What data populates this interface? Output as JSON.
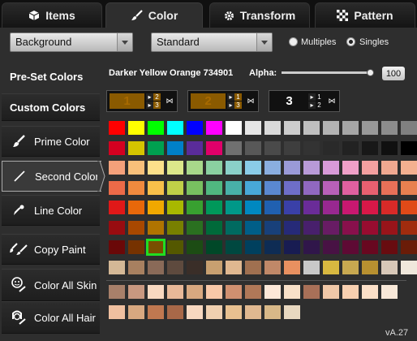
{
  "tabs": [
    {
      "label": "Items",
      "icon": "cube-icon"
    },
    {
      "label": "Color",
      "icon": "paintbrush-icon"
    },
    {
      "label": "Transform",
      "icon": "gear-icon"
    },
    {
      "label": "Pattern",
      "icon": "checker-icon"
    }
  ],
  "controls": {
    "target_select": "Background",
    "mode_select": "Standard",
    "radio_multiples": "Multiples",
    "radio_singles": "Singles",
    "selected_radio": "Singles"
  },
  "sidebar": {
    "preset_label": "Pre-Set Colors",
    "custom_label": "Custom Colors",
    "buttons": [
      {
        "label": "Prime Color",
        "icon": "brush-icon"
      },
      {
        "label": "Second Color",
        "icon": "pencil-icon",
        "active": true
      },
      {
        "label": "Line Color",
        "icon": "pen-icon"
      },
      {
        "label": "Copy Paint",
        "icon": "copy-paint-icon"
      },
      {
        "label": "Color All Skin",
        "icon": "skin-icon"
      },
      {
        "label": "Color All Hair",
        "icon": "hair-icon"
      }
    ]
  },
  "color_name": "Darker Yellow Orange 734901",
  "alpha": {
    "label": "Alpha:",
    "value": "100"
  },
  "slots": [
    {
      "number": "1",
      "color": "#8a5a00",
      "mini": [
        "▸",
        "2",
        "▸",
        "3"
      ]
    },
    {
      "number": "2",
      "color": "#8a5a00",
      "mini": [
        "▸",
        "1",
        "▸",
        "3"
      ]
    },
    {
      "number": "3",
      "color": "#111111",
      "mini": [
        "▸",
        "1",
        "▸",
        "2"
      ]
    }
  ],
  "palette_rows": [
    [
      "#ff0000",
      "#ffff00",
      "#00ff00",
      "#00ffff",
      "#0000ff",
      "#ff00ff",
      "#ffffff",
      "#e6e6e6",
      "#d9d9d9",
      "#cccccc",
      "#bfbfbf",
      "#b3b3b3",
      "#a6a6a6",
      "#999999",
      "#8c8c8c",
      "#808080"
    ],
    [
      "#d40020",
      "#d4c400",
      "#00a050",
      "#0080c8",
      "#5a2c9a",
      "#e0006a",
      "#707070",
      "#585858",
      "#4a4a4a",
      "#3e3e3e",
      "#333333",
      "#2a2a2a",
      "#222222",
      "#181818",
      "#101010",
      "#000000"
    ],
    [
      "#f4a07a",
      "#f8c07a",
      "#fce08a",
      "#dce88a",
      "#a8d88a",
      "#8ad0a0",
      "#8ad0c8",
      "#8acce8",
      "#8aaee0",
      "#9a9ad8",
      "#b89ad8",
      "#d89ad8",
      "#f0a0c8",
      "#f4a0a0",
      "#f0a890",
      "#f4b090"
    ],
    [
      "#ec6a48",
      "#f08a3e",
      "#f8c04a",
      "#c0d048",
      "#78c060",
      "#50b880",
      "#48b0a8",
      "#48a8d8",
      "#5a88d0",
      "#6e6ec8",
      "#9068c0",
      "#b860b8",
      "#e060a0",
      "#e86070",
      "#e87058",
      "#e88050"
    ],
    [
      "#e01818",
      "#e8680a",
      "#f0a800",
      "#a8b800",
      "#38a030",
      "#00985a",
      "#009888",
      "#0088c0",
      "#2060b0",
      "#3a40a8",
      "#6a2c98",
      "#982890",
      "#c81870",
      "#d81848",
      "#d82a28",
      "#e04a18"
    ],
    [
      "#980c10",
      "#a84800",
      "#b07400",
      "#788000",
      "#2a7020",
      "#006a3a",
      "#006a60",
      "#005e88",
      "#18407a",
      "#262a78",
      "#48206c",
      "#681c64",
      "#88104c",
      "#980c30",
      "#98141a",
      "#a02c0e"
    ],
    [
      "#6a0808",
      "#763200",
      "#784f00",
      "#545800",
      "#1c4c14",
      "#004828",
      "#004840",
      "#00405e",
      "#0e2c54",
      "#181c52",
      "#30164a",
      "#481244",
      "#5e0a34",
      "#680820",
      "#680c10",
      "#6a1c08"
    ],
    [
      "#d4b896",
      "#a88060",
      "#8a6a58",
      "#5e4a3e",
      "#3a2e28",
      "#c8a070",
      "#e0b890",
      "#a07050",
      "#c08868",
      "#e89060",
      "#c8c8c8",
      "#d8b840",
      "#c8a850",
      "#b89030",
      "#d8c8b8",
      "#f0e8dc"
    ]
  ],
  "skin_rows": [
    [
      "#a8806a",
      "#c89880",
      "#f8d8c0",
      "#e8b898",
      "#d8a880",
      "#f8c8a8",
      "#d09070",
      "#b07858",
      "#fde8d8",
      "#f8e0c8",
      "#a87058",
      "#f0c8a8",
      "#f8d0b0",
      "#fce0c8",
      "#f8e8d8"
    ],
    [
      "#f0c0a0",
      "#d8a880",
      "#c07850",
      "#a86848",
      "#f8d8c0",
      "#f0d0b0",
      "#e8c090",
      "#e0b890",
      "#d8b888",
      "#e8d8c0"
    ]
  ],
  "selected_swatch": {
    "row": 6,
    "col": 2
  },
  "version": "vA.27"
}
